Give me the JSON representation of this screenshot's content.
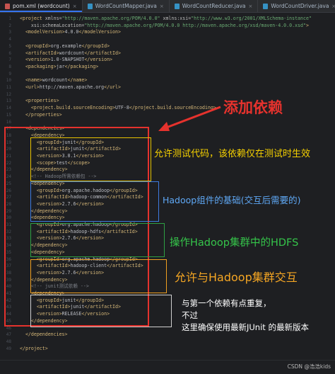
{
  "tabs": [
    {
      "label": "pom.xml (wordcount)",
      "icon": "maven-file-icon",
      "color": "#c75450",
      "active": true
    },
    {
      "label": "WordCountMapper.java",
      "icon": "java-class-icon",
      "color": "#3592c4",
      "active": false
    },
    {
      "label": "WordCountReducer.java",
      "icon": "java-class-icon",
      "color": "#3592c4",
      "active": false
    },
    {
      "label": "WordCountDriver.java",
      "icon": "java-class-icon",
      "color": "#3592c4",
      "active": false
    }
  ],
  "lines": [
    "1",
    "2",
    "3",
    "4",
    "5",
    "6",
    "7",
    "8",
    "9",
    "10",
    "11",
    "12",
    "13",
    "14",
    "15",
    "16",
    "17",
    "18",
    "19",
    "20",
    "21",
    "22",
    "23",
    "24",
    "25",
    "26",
    "27",
    "28",
    "29",
    "30",
    "31",
    "32",
    "33",
    "34",
    "35",
    "36",
    "37",
    "38",
    "39",
    "40",
    "41",
    "42",
    "43",
    "44",
    "45",
    "46",
    "47",
    "48",
    "49"
  ],
  "code": [
    [
      [
        "tg",
        "<project "
      ],
      [
        "at",
        "xmlns="
      ],
      [
        "av",
        "\"http://maven.apache.org/POM/4.0.0\" "
      ],
      [
        "at",
        "xmlns:xsi="
      ],
      [
        "av",
        "\"http://www.w3.org/2001/XMLSchema-instance\""
      ]
    ],
    [
      [
        "tx",
        "    "
      ],
      [
        "at",
        "xsi:schemaLocation="
      ],
      [
        "av",
        "\"http://maven.apache.org/POM/4.0.0 http://maven.apache.org/xsd/maven-4.0.0.xsd\""
      ],
      [
        "tg",
        ">"
      ]
    ],
    [
      [
        "tx",
        "  "
      ],
      [
        "tg",
        "<modelVersion>"
      ],
      [
        "tx",
        "4.0.0"
      ],
      [
        "tg",
        "</modelVersion>"
      ]
    ],
    [
      [
        "tx",
        ""
      ]
    ],
    [
      [
        "tx",
        "  "
      ],
      [
        "tg",
        "<groupId>"
      ],
      [
        "tx",
        "org.example"
      ],
      [
        "tg",
        "</groupId>"
      ]
    ],
    [
      [
        "tx",
        "  "
      ],
      [
        "tg",
        "<artifactId>"
      ],
      [
        "tx",
        "wordcount"
      ],
      [
        "tg",
        "</artifactId>"
      ]
    ],
    [
      [
        "tx",
        "  "
      ],
      [
        "tg",
        "<version>"
      ],
      [
        "tx",
        "1.0-SNAPSHOT"
      ],
      [
        "tg",
        "</version>"
      ]
    ],
    [
      [
        "tx",
        "  "
      ],
      [
        "tg",
        "<packaging>"
      ],
      [
        "tx",
        "jar"
      ],
      [
        "tg",
        "</packaging>"
      ]
    ],
    [
      [
        "tx",
        ""
      ]
    ],
    [
      [
        "tx",
        "  "
      ],
      [
        "tg",
        "<name>"
      ],
      [
        "tx",
        "wordcount"
      ],
      [
        "tg",
        "</name>"
      ]
    ],
    [
      [
        "tx",
        "  "
      ],
      [
        "tg",
        "<url>"
      ],
      [
        "tx",
        "http://maven.apache.org"
      ],
      [
        "tg",
        "</url>"
      ]
    ],
    [
      [
        "tx",
        ""
      ]
    ],
    [
      [
        "tx",
        "  "
      ],
      [
        "tg",
        "<properties>"
      ]
    ],
    [
      [
        "tx",
        "    "
      ],
      [
        "tg",
        "<project.build.sourceEncoding>"
      ],
      [
        "tx",
        "UTF-8"
      ],
      [
        "tg",
        "</project.build.sourceEncoding>"
      ]
    ],
    [
      [
        "tx",
        "  "
      ],
      [
        "tg",
        "</properties>"
      ]
    ],
    [
      [
        "tx",
        ""
      ]
    ],
    [
      [
        "tx",
        "  "
      ],
      [
        "tg",
        "<dependencies>"
      ]
    ],
    [
      [
        "tx",
        "    "
      ],
      [
        "tg",
        "<dependency>"
      ]
    ],
    [
      [
        "tx",
        "      "
      ],
      [
        "tg",
        "<groupId>"
      ],
      [
        "tx",
        "junit"
      ],
      [
        "tg",
        "</groupId>"
      ]
    ],
    [
      [
        "tx",
        "      "
      ],
      [
        "tg",
        "<artifactId>"
      ],
      [
        "tx",
        "junit"
      ],
      [
        "tg",
        "</artifactId>"
      ]
    ],
    [
      [
        "tx",
        "      "
      ],
      [
        "tg",
        "<version>"
      ],
      [
        "tx",
        "3.8.1"
      ],
      [
        "tg",
        "</version>"
      ]
    ],
    [
      [
        "tx",
        "      "
      ],
      [
        "tg",
        "<scope>"
      ],
      [
        "tx",
        "test"
      ],
      [
        "tg",
        "</scope>"
      ]
    ],
    [
      [
        "tx",
        "    "
      ],
      [
        "tg",
        "</dependency>"
      ]
    ],
    [
      [
        "tx",
        "    "
      ],
      [
        "cm",
        "<!-- Hadoop所需依赖包 -->"
      ]
    ],
    [
      [
        "tx",
        "    "
      ],
      [
        "tg",
        "<dependency>"
      ]
    ],
    [
      [
        "tx",
        "      "
      ],
      [
        "tg",
        "<groupId>"
      ],
      [
        "tx",
        "org.apache.hadoop"
      ],
      [
        "tg",
        "</groupId>"
      ]
    ],
    [
      [
        "tx",
        "      "
      ],
      [
        "tg",
        "<artifactId>"
      ],
      [
        "tx",
        "hadoop-common"
      ],
      [
        "tg",
        "</artifactId>"
      ]
    ],
    [
      [
        "tx",
        "      "
      ],
      [
        "tg",
        "<version>"
      ],
      [
        "tx",
        "2.7.6"
      ],
      [
        "tg",
        "</version>"
      ]
    ],
    [
      [
        "tx",
        "    "
      ],
      [
        "tg",
        "</dependency>"
      ]
    ],
    [
      [
        "tx",
        "    "
      ],
      [
        "tg",
        "<dependency>"
      ]
    ],
    [
      [
        "tx",
        "      "
      ],
      [
        "tg",
        "<groupId>"
      ],
      [
        "tx",
        "org.apache.hadoop"
      ],
      [
        "tg",
        "</groupId>"
      ]
    ],
    [
      [
        "tx",
        "      "
      ],
      [
        "tg",
        "<artifactId>"
      ],
      [
        "tx",
        "hadoop-hdfs"
      ],
      [
        "tg",
        "</artifactId>"
      ]
    ],
    [
      [
        "tx",
        "      "
      ],
      [
        "tg",
        "<version>"
      ],
      [
        "tx",
        "2.7.6"
      ],
      [
        "tg",
        "</version>"
      ]
    ],
    [
      [
        "tx",
        "    "
      ],
      [
        "tg",
        "</dependency>"
      ]
    ],
    [
      [
        "tx",
        "    "
      ],
      [
        "tg",
        "<dependency>"
      ]
    ],
    [
      [
        "tx",
        "      "
      ],
      [
        "tg",
        "<groupId>"
      ],
      [
        "tx",
        "org.apache.hadoop"
      ],
      [
        "tg",
        "</groupId>"
      ]
    ],
    [
      [
        "tx",
        "      "
      ],
      [
        "tg",
        "<artifactId>"
      ],
      [
        "tx",
        "hadoop-client"
      ],
      [
        "tg",
        "</artifactId>"
      ]
    ],
    [
      [
        "tx",
        "      "
      ],
      [
        "tg",
        "<version>"
      ],
      [
        "tx",
        "2.7.6"
      ],
      [
        "tg",
        "</version>"
      ]
    ],
    [
      [
        "tx",
        "    "
      ],
      [
        "tg",
        "</dependency>"
      ]
    ],
    [
      [
        "tx",
        "    "
      ],
      [
        "cm",
        "<!-- junit测试依赖 -->"
      ]
    ],
    [
      [
        "tx",
        "    "
      ],
      [
        "tg",
        "<dependency>"
      ]
    ],
    [
      [
        "tx",
        "      "
      ],
      [
        "tg",
        "<groupId>"
      ],
      [
        "tx",
        "junit"
      ],
      [
        "tg",
        "</groupId>"
      ]
    ],
    [
      [
        "tx",
        "      "
      ],
      [
        "tg",
        "<artifactId>"
      ],
      [
        "tx",
        "junit"
      ],
      [
        "tg",
        "</artifactId>"
      ]
    ],
    [
      [
        "tx",
        "      "
      ],
      [
        "tg",
        "<version>"
      ],
      [
        "tx",
        "RELEASE"
      ],
      [
        "tg",
        "</version>"
      ]
    ],
    [
      [
        "tx",
        "    "
      ],
      [
        "tg",
        "</dependency>"
      ]
    ],
    [
      [
        "tx",
        ""
      ]
    ],
    [
      [
        "tx",
        "  "
      ],
      [
        "tg",
        "</dependencies>"
      ]
    ],
    [
      [
        "tx",
        ""
      ]
    ],
    [
      [
        "tg",
        "</project>"
      ]
    ]
  ],
  "annotations": {
    "add_dependency": "添加依赖",
    "junit_test": "允许测试代码，该依赖仅在测试时生效",
    "hadoop_common": "Hadoop组件的基础(交互后需要的)",
    "hadoop_hdfs": "操作Hadoop集群中的HDFS",
    "hadoop_client": "允许与Hadoop集群交互",
    "junit_note_1": "与第一个依赖有点重复，",
    "junit_note_2": "不过",
    "junit_note_3": "这里确保使用最新JUnit 的最新版本"
  },
  "colors": {
    "arrow_red": "#e5322d",
    "box_yellow": "#e8c200",
    "box_blue": "#3d7be0",
    "box_green": "#2ea043",
    "box_orange": "#f0a020",
    "box_white": "#d0d0d0",
    "text_yellow": "#f5d000",
    "text_blue": "#5fa8f5",
    "text_green": "#35c54a",
    "text_orange": "#f5a623"
  },
  "watermark": "CSDN @浩浩kids"
}
